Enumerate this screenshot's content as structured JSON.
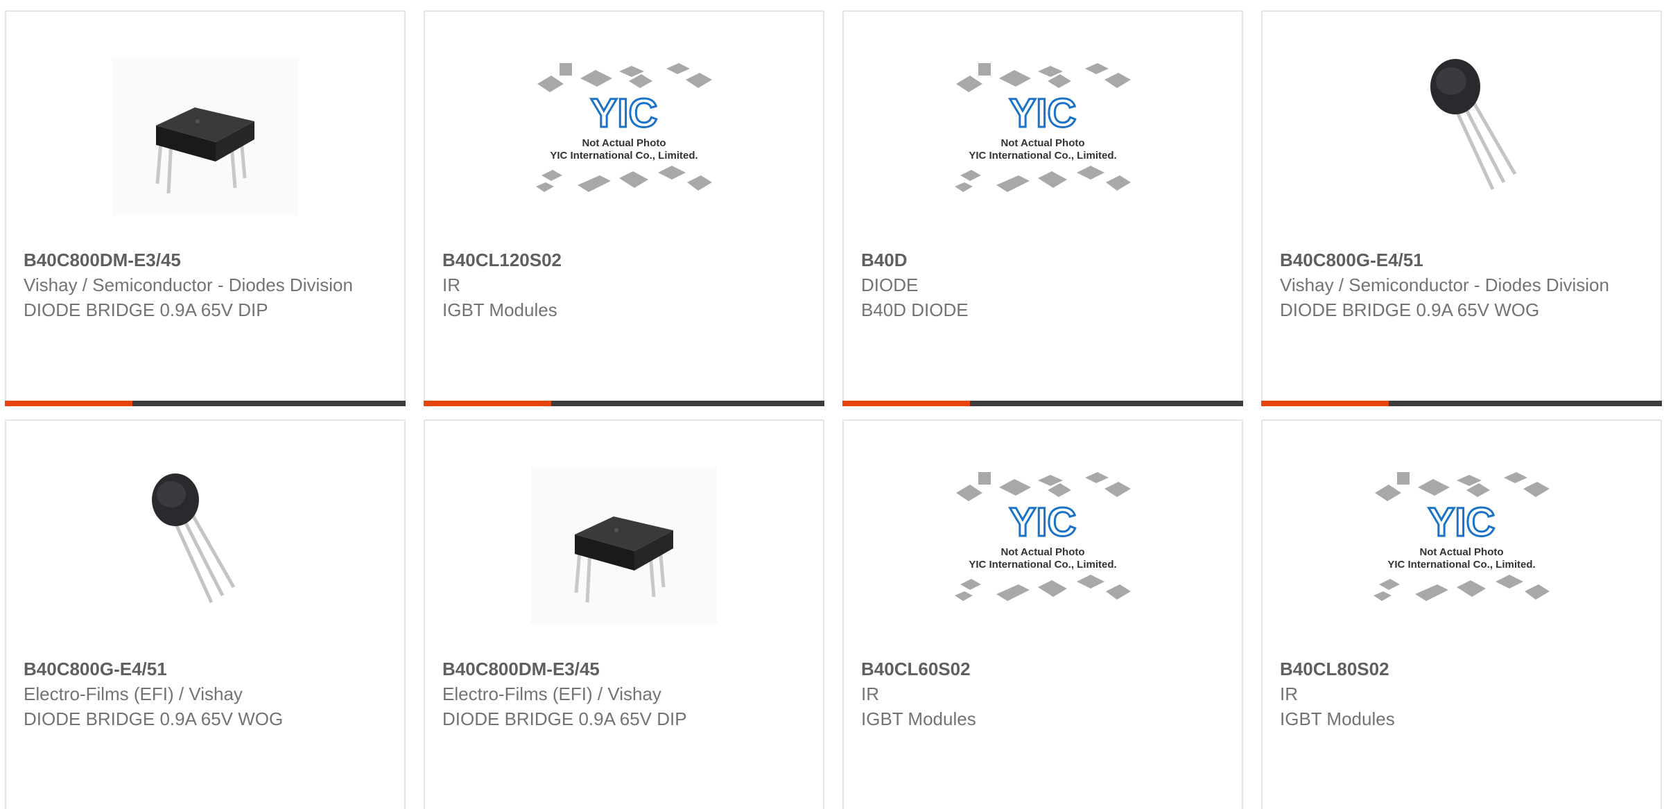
{
  "products": [
    {
      "part_number": "B40C800DM-E3/45",
      "manufacturer": "Vishay / Semiconductor - Diodes Division",
      "description": "DIODE BRIDGE 0.9A 65V DIP",
      "image": "dip-bridge-photo"
    },
    {
      "part_number": "B40CL120S02",
      "manufacturer": "IR",
      "description": "IGBT Modules",
      "image": "not-actual-photo-placeholder"
    },
    {
      "part_number": "B40D",
      "manufacturer": "DIODE",
      "description": "B40D DIODE",
      "image": "not-actual-photo-placeholder"
    },
    {
      "part_number": "B40C800G-E4/51",
      "manufacturer": "Vishay / Semiconductor - Diodes Division",
      "description": "DIODE BRIDGE 0.9A 65V WOG",
      "image": "wog-bridge-photo"
    },
    {
      "part_number": "B40C800G-E4/51",
      "manufacturer": "Electro-Films (EFI) / Vishay",
      "description": "DIODE BRIDGE 0.9A 65V WOG",
      "image": "wog-bridge-photo"
    },
    {
      "part_number": "B40C800DM-E3/45",
      "manufacturer": "Electro-Films (EFI) / Vishay",
      "description": "DIODE BRIDGE 0.9A 65V DIP",
      "image": "dip-bridge-photo"
    },
    {
      "part_number": "B40CL60S02",
      "manufacturer": "IR",
      "description": "IGBT Modules",
      "image": "not-actual-photo-placeholder"
    },
    {
      "part_number": "B40CL80S02",
      "manufacturer": "IR",
      "description": "IGBT Modules",
      "image": "not-actual-photo-placeholder"
    }
  ],
  "placeholder": {
    "logo_text": "YIC",
    "line1": "Not Actual Photo",
    "line2": "YIC International Co., Limited."
  },
  "colors": {
    "accent": "#e8440f",
    "bar": "#3c3c3c",
    "text": "#737373",
    "logo": "#1a73c9"
  }
}
